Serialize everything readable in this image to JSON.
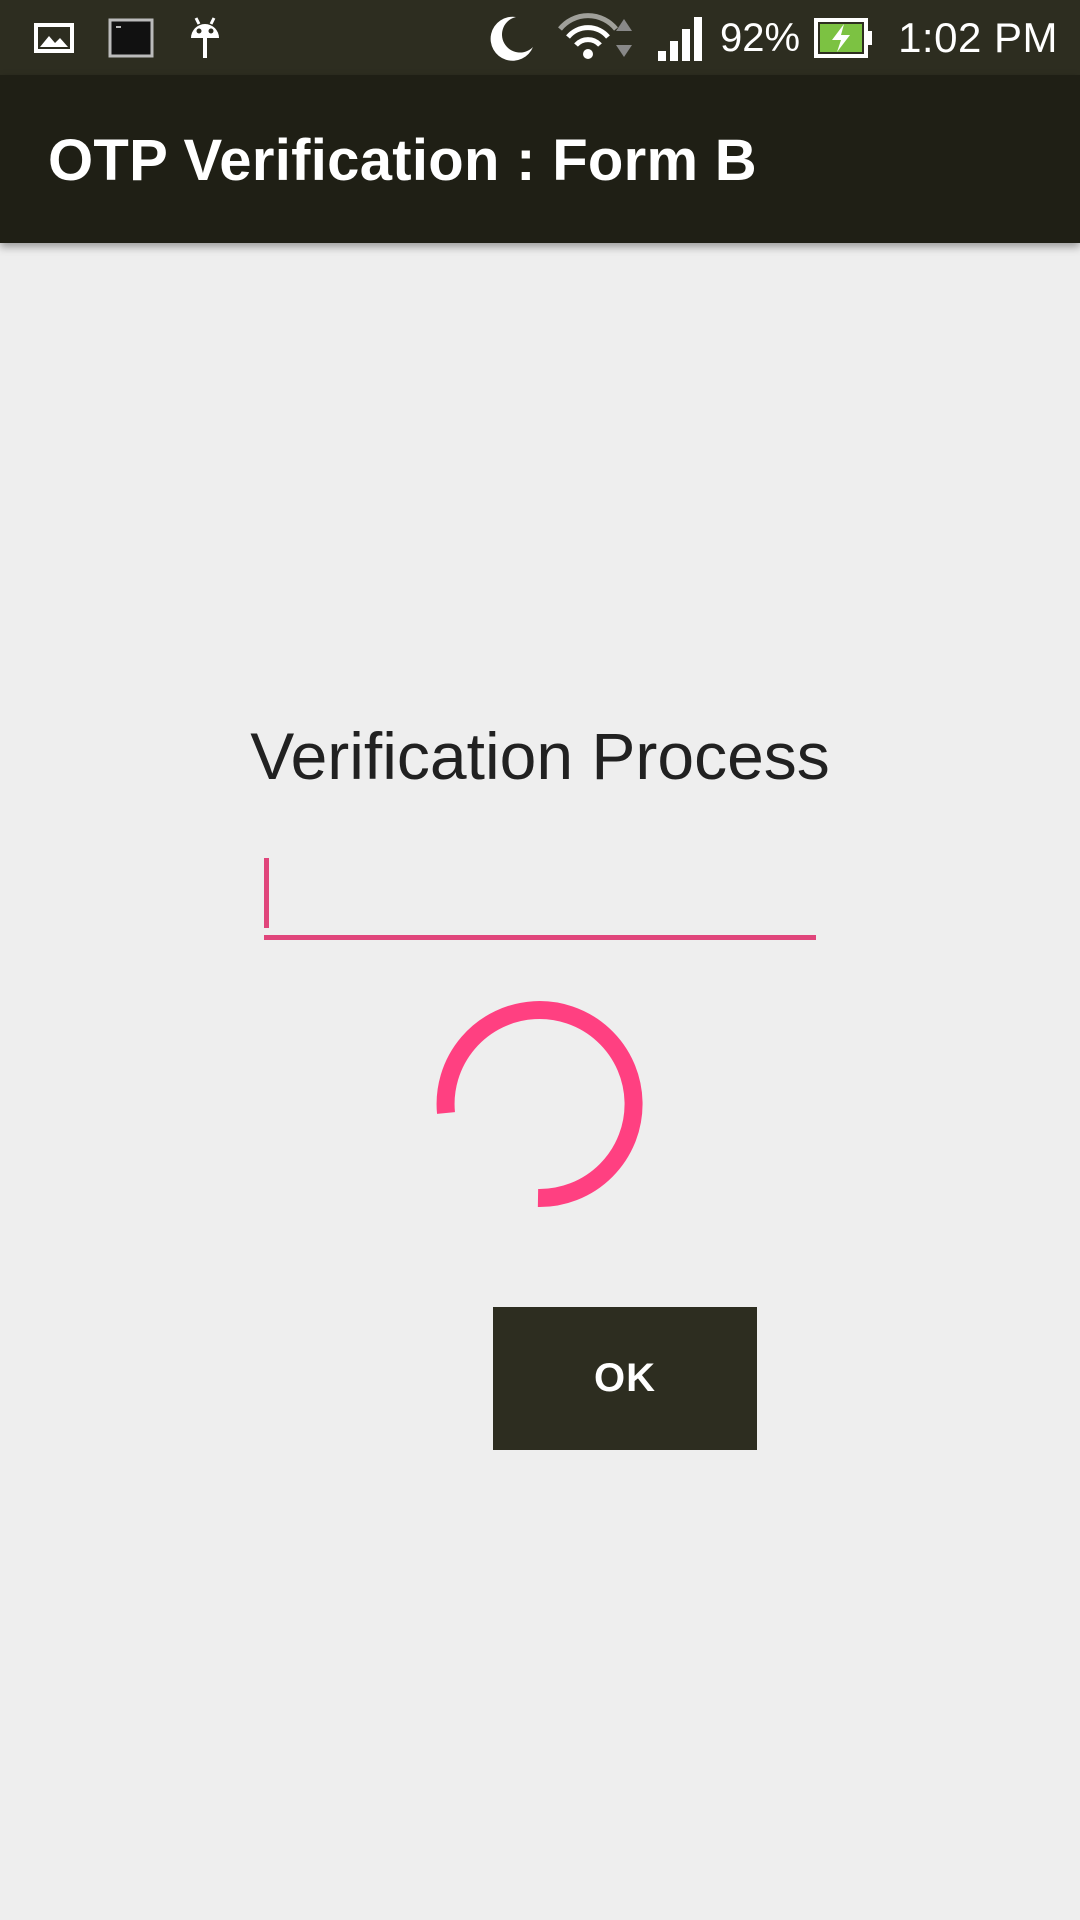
{
  "status_bar": {
    "left_icons": [
      "image-icon",
      "terminal-icon",
      "android-icon"
    ],
    "right_icons": [
      "moon-icon",
      "wifi-icon",
      "signal-icon",
      "battery-charging-icon"
    ],
    "battery_percent": "92%",
    "time": "1:02 PM"
  },
  "app_bar": {
    "title": "OTP Verification : Form B"
  },
  "main": {
    "heading": "Verification Process",
    "otp_input": {
      "value": "",
      "placeholder": ""
    },
    "ok_label": "OK"
  },
  "colors": {
    "accent": "#e0457b",
    "spinner": "#ff4081",
    "app_bar": "#1f1f15",
    "status_bar": "#2d2d20",
    "button": "#2d2d20",
    "background": "#eeeeee"
  }
}
